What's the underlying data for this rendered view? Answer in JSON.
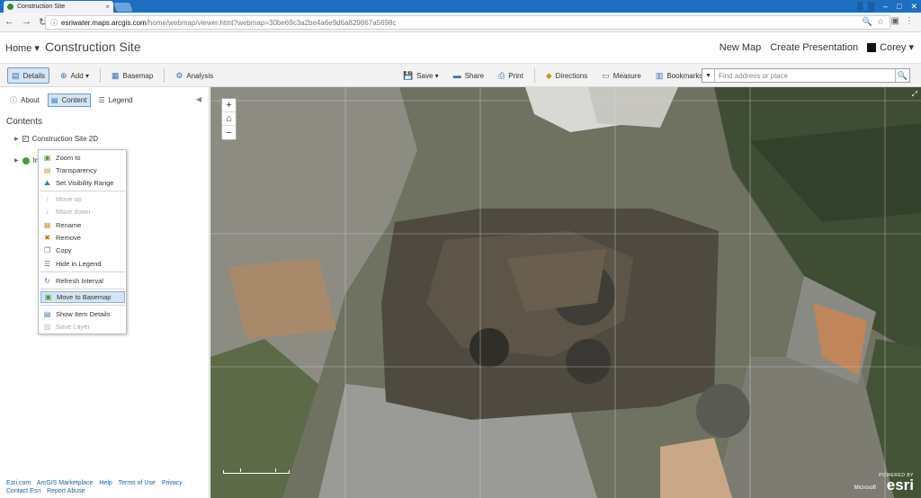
{
  "browser": {
    "tab_title": "Construction Site",
    "tab_close": "×",
    "url_host": "esriwater.maps.arcgis.com",
    "url_path": "/home/webmap/viewer.html?webmap=30be69c3a2be4a6e9d6a829867a5698c",
    "window_controls": [
      "–",
      "□",
      "✕"
    ]
  },
  "header": {
    "home_label": "Home ▾",
    "title": "Construction Site",
    "new_map": "New Map",
    "create_presentation": "Create Presentation",
    "user": "Corey ▾"
  },
  "toolbar": {
    "details": "Details",
    "add": "Add ▾",
    "basemap": "Basemap",
    "analysis": "Analysis",
    "save": "Save ▾",
    "share": "Share",
    "print": "Print",
    "directions": "Directions",
    "measure": "Measure",
    "bookmarks": "Bookmarks",
    "search_placeholder": "Find address or place"
  },
  "panel": {
    "tabs": [
      "About",
      "Content",
      "Legend"
    ],
    "contents_title": "Contents",
    "layers": [
      "Construction Site 2D",
      "Im"
    ],
    "context_menu": [
      {
        "label": "Zoom to",
        "enabled": true,
        "icon": "zoom-to-icon"
      },
      {
        "label": "Transparency",
        "enabled": true,
        "icon": "transparency-icon"
      },
      {
        "label": "Set Visibility Range",
        "enabled": true,
        "icon": "visibility-range-icon"
      },
      {
        "label": "Move up",
        "enabled": false,
        "icon": "arrow-up-icon"
      },
      {
        "label": "Move down",
        "enabled": false,
        "icon": "arrow-down-icon"
      },
      {
        "label": "Rename",
        "enabled": true,
        "icon": "rename-icon"
      },
      {
        "label": "Remove",
        "enabled": true,
        "icon": "remove-icon"
      },
      {
        "label": "Copy",
        "enabled": true,
        "icon": "copy-icon"
      },
      {
        "label": "Hide in Legend",
        "enabled": true,
        "icon": "hide-legend-icon"
      },
      {
        "label": "Refresh Interval",
        "enabled": true,
        "icon": "refresh-icon"
      },
      {
        "label": "Move to Basemap",
        "enabled": true,
        "highlighted": true,
        "icon": "move-to-basemap-icon"
      },
      {
        "label": "Show Item Details",
        "enabled": true,
        "icon": "item-details-icon"
      },
      {
        "label": "Save Layer",
        "enabled": false,
        "icon": "save-layer-icon"
      }
    ],
    "footer_links": [
      "Esri.com",
      "ArcGIS Marketplace",
      "Help",
      "Terms of Use",
      "Privacy",
      "Contact Esri",
      "Report Abuse"
    ]
  },
  "map": {
    "zoom_in": "+",
    "home": "⌂",
    "zoom_out": "−",
    "attribution": "Microsoft",
    "powered_by": "POWERED BY",
    "esri_logo": "esri"
  },
  "colors": {
    "accent": "#1e6fbf",
    "active_bg": "#d5e4f3",
    "link": "#1f5fa8"
  }
}
